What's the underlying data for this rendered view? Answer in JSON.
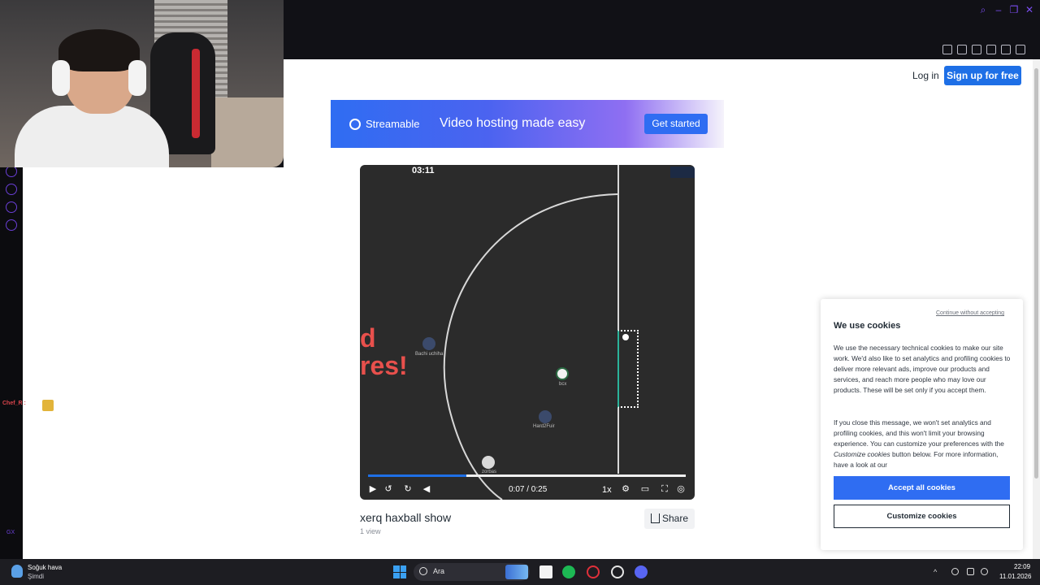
{
  "header": {
    "login_label": "Log in",
    "signup_label": "Sign up for free"
  },
  "banner": {
    "brand": "Streamable",
    "tagline": "Video hosting made easy",
    "cta": "Get started"
  },
  "video": {
    "timer": "03:11",
    "overlay_line1": "d",
    "overlay_line2": "res!",
    "players": [
      "Bachi uchiha",
      "bcx",
      "Hard2Fuir",
      "zorbas"
    ],
    "time_readout": "0:07 / 0:25",
    "speed": "1x",
    "progress": 0.31,
    "title": "xerq haxball show",
    "views": "1 view",
    "share_label": "Share"
  },
  "cookie": {
    "skip": "Continue without accepting",
    "title": "We use cookies",
    "p1": "We use the necessary technical cookies to make our site work. We'd also like to set analytics and profiling cookies to deliver more relevant ads, improve our products and services, and reach more people who may love our products. These will be set only if you accept them.",
    "p2_a": "If you close this message, we won't set analytics and profiling cookies, and this won't limit your browsing experience. You can customize your preferences with the ",
    "p2_em": "Customize cookies",
    "p2_b": " button below. For more information, have a look at our",
    "accept": "Accept all cookies",
    "customize": "Customize cookies"
  },
  "chat": {
    "user": "Chef_R :"
  },
  "sidebar": {
    "gx_label": "GX"
  },
  "taskbar": {
    "weather_title": "Soğuk hava",
    "weather_sub": "Şimdi",
    "search_placeholder": "Ara",
    "time": "22:09",
    "date": "11.01.2026"
  },
  "colors": {
    "accent": "#1e6fe6",
    "opera_purple": "#6a3fd6"
  }
}
